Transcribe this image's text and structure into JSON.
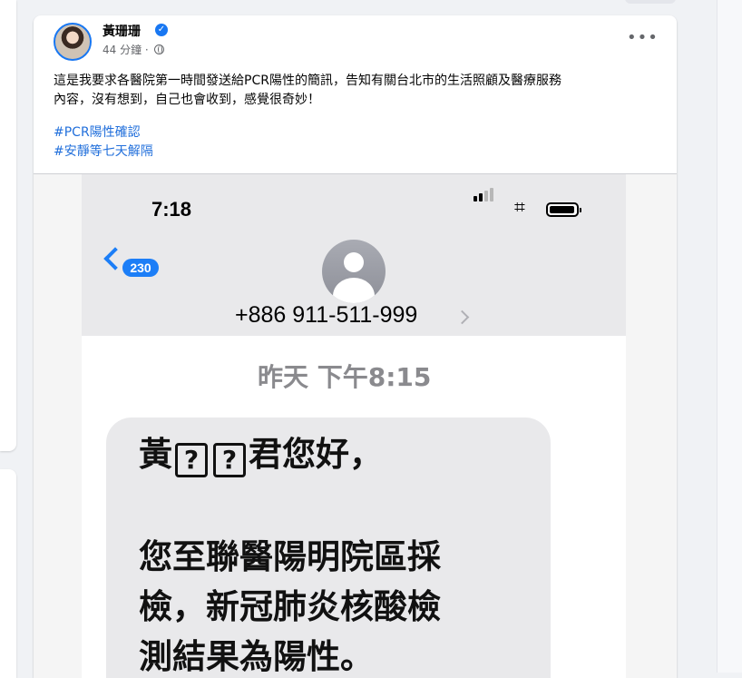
{
  "post": {
    "author": "黃珊珊",
    "time": "44 分鐘",
    "separator": "·",
    "body_line1": "這是我要求各醫院第一時間發送給PCR陽性的簡訊，告知有關台北市的生活照顧及醫療服務",
    "body_line2": "內容，沒有想到，自己也會收到，感覺很奇妙！",
    "hashtags": [
      "#PCR陽性確認",
      "#安靜等七天解隔"
    ],
    "more_label": "•••",
    "verified_glyph": "✓"
  },
  "sms": {
    "status_time": "7:18",
    "back_count": "230",
    "phone_number": "+886 911-511-999",
    "date": "昨天 下午8:15",
    "greeting_prefix": "黃",
    "missing_glyph": "?",
    "greeting_suffix": "君您好，",
    "line2": "您至聯醫陽明院區採",
    "line3": "檢，新冠肺炎核酸檢",
    "line4": "測結果為陽性。"
  },
  "colors": {
    "accent": "#1877f2",
    "hashtag": "#216fdb",
    "ios_blue": "#1c7ef7",
    "bubble": "#e9e9eb"
  }
}
